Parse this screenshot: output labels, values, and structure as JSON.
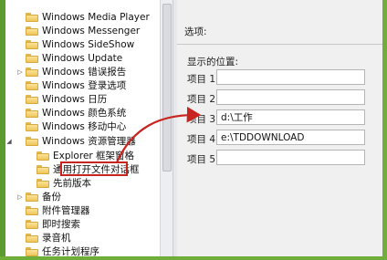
{
  "tree": {
    "items": [
      {
        "label": "Windows Media Player",
        "toggle": ""
      },
      {
        "label": "Windows Messenger",
        "toggle": ""
      },
      {
        "label": "Windows SideShow",
        "toggle": ""
      },
      {
        "label": "Windows Update",
        "toggle": ""
      },
      {
        "label": "Windows 错误报告",
        "toggle": "▷"
      },
      {
        "label": "Windows 登录选项",
        "toggle": ""
      },
      {
        "label": "Windows 日历",
        "toggle": ""
      },
      {
        "label": "Windows 颜色系统",
        "toggle": ""
      },
      {
        "label": "Windows 移动中心",
        "toggle": ""
      },
      {
        "label": "Windows 资源管理器",
        "toggle": "◢"
      },
      {
        "label": "Explorer 框架窗格",
        "toggle": ""
      },
      {
        "label": "通用打开文件对话框",
        "toggle": ""
      },
      {
        "label": "先前版本",
        "toggle": ""
      },
      {
        "label": "备份",
        "toggle": "▷"
      },
      {
        "label": "附件管理器",
        "toggle": ""
      },
      {
        "label": "即时搜索",
        "toggle": ""
      },
      {
        "label": "录音机",
        "toggle": ""
      },
      {
        "label": "任务计划程序",
        "toggle": ""
      },
      {
        "label": "...",
        "toggle": ""
      }
    ]
  },
  "options": {
    "title": "选项:",
    "places_label": "显示的位置:",
    "rows": [
      {
        "label": "项目 1",
        "value": ""
      },
      {
        "label": "项目 2",
        "value": ""
      },
      {
        "label": "项目 3",
        "value": "d:\\工作"
      },
      {
        "label": "项目 4",
        "value": "e:\\TDDOWNLOAD"
      },
      {
        "label": "项目 5",
        "value": ""
      }
    ]
  },
  "colors": {
    "highlight": "#c82420",
    "frame": "#5a9a2e"
  }
}
